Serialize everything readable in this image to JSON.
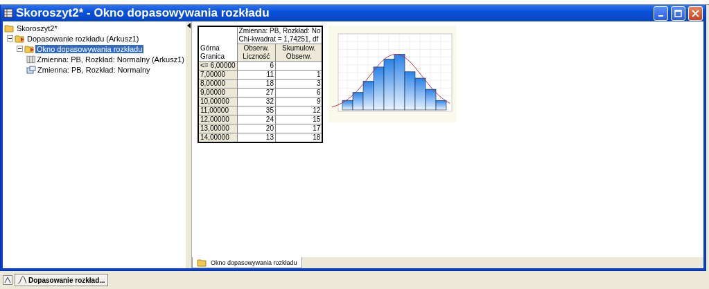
{
  "window": {
    "title": "Skoroszyt2* - Okno dopasowywania rozkładu"
  },
  "tree": {
    "label": "Skoroszyt2*",
    "children": [
      {
        "label": "Dopasowanie rozkładu (Arkusz1)",
        "kind": "folder",
        "expanded": true,
        "selected": false,
        "children": [
          {
            "label": "Okno dopasowywania rozkładu",
            "kind": "folder",
            "expanded": true,
            "selected": true,
            "children": [
              {
                "label": "Zmienna: PB, Rozkład: Normalny (Arkusz1)",
                "kind": "sheet",
                "selected": false
              },
              {
                "label": "Zmienna:  PB, Rozkład: Normalny",
                "kind": "graph",
                "selected": false
              }
            ]
          }
        ]
      }
    ]
  },
  "table": {
    "group_header": [
      "Zmienna: PB, Rozkład: No",
      "Chi-kwadrat = 1,74251, df"
    ],
    "columns": [
      "Górna\nGranica",
      "Obserw.\nLiczność",
      "Skumulow.\nObserw."
    ],
    "rows": [
      [
        "<= 6,00000",
        "6",
        ""
      ],
      [
        "7,00000",
        "11",
        "1"
      ],
      [
        "8,00000",
        "18",
        "3"
      ],
      [
        "9,00000",
        "27",
        "6"
      ],
      [
        "10,00000",
        "32",
        "9"
      ],
      [
        "11,00000",
        "35",
        "12"
      ],
      [
        "12,00000",
        "24",
        "15"
      ],
      [
        "13,00000",
        "20",
        "17"
      ],
      [
        "14,00000",
        "13",
        "18"
      ]
    ]
  },
  "doc_tabs": [
    {
      "label": "Okno dopasowywania rozkładu",
      "selected": true
    }
  ],
  "taskbar": {
    "items": [
      {
        "label": "Dopasowanie rozkład..."
      }
    ]
  }
}
